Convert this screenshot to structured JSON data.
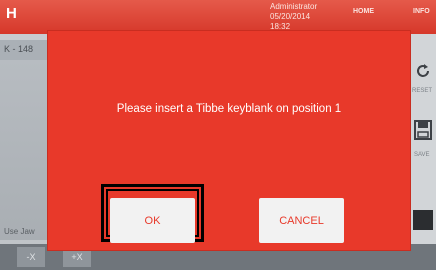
{
  "app": {
    "logo": "H",
    "top_info_line1": "Administrator",
    "top_info_line2": "05/20/2014",
    "top_info_line3": "18:32",
    "home_label": "HOME",
    "info_label": "INFO"
  },
  "background": {
    "left_field": "K - 148",
    "left_label": "Use Jaw",
    "bottom_buttons": [
      "-X",
      "+X"
    ],
    "reset_label": "RESET",
    "save_label": "SAVE"
  },
  "dialog": {
    "message": "Please insert a Tibbe keyblank on position 1",
    "ok_label": "OK",
    "cancel_label": "CANCEL"
  },
  "colors": {
    "dialog_red": "#e8392a",
    "button_bg": "#f2f2f2",
    "highlight_frame": "#000000"
  }
}
